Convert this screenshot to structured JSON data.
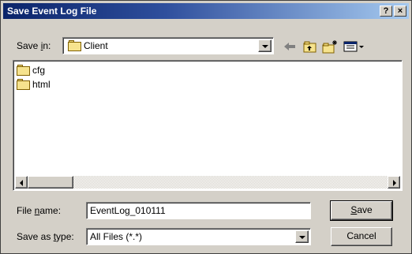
{
  "window": {
    "title": "Save Event Log File",
    "help_label": "?",
    "close_label": "×"
  },
  "save_in": {
    "label_pre": "Save ",
    "label_accel": "i",
    "label_post": "n:",
    "value": "Client"
  },
  "toolbar": {
    "back_icon": "back-arrow-icon",
    "up_icon": "up-folder-icon",
    "new_folder_icon": "new-folder-icon",
    "views_icon": "views-menu-icon"
  },
  "files": [
    {
      "name": "cfg",
      "icon": "folder-icon"
    },
    {
      "name": "html",
      "icon": "folder-icon"
    }
  ],
  "file_name": {
    "label_pre": "File ",
    "label_accel": "n",
    "label_post": "ame:",
    "value": "EventLog_010111"
  },
  "save_as_type": {
    "label_pre": "Save as ",
    "label_accel": "t",
    "label_post": "ype:",
    "value": "All Files (*.*)"
  },
  "buttons": {
    "save_accel": "S",
    "save_rest": "ave",
    "cancel": "Cancel"
  },
  "colors": {
    "titlebar_start": "#0a246a",
    "titlebar_end": "#a6caf0",
    "dialog_bg": "#d4d0c8"
  }
}
